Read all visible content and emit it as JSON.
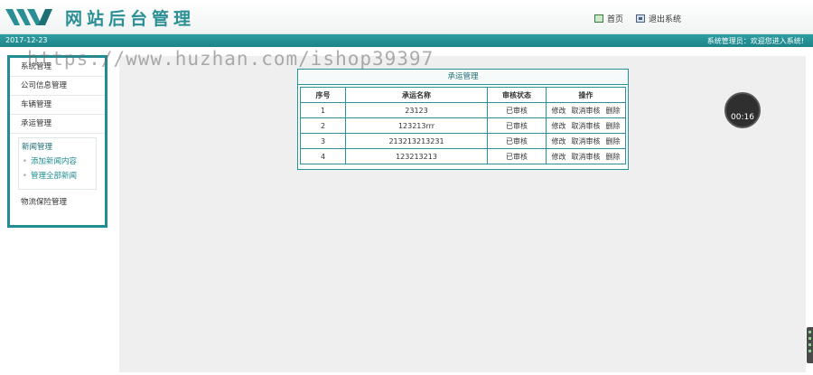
{
  "header": {
    "title": "网站后台管理",
    "home_label": "首页",
    "logout_label": "退出系统"
  },
  "statusbar": {
    "date": "2017-12-23",
    "welcome": "系统管理员：欢迎您进入系统!"
  },
  "sidebar": {
    "items": [
      {
        "label": "系统管理"
      },
      {
        "label": "公司信息管理"
      },
      {
        "label": "车辆管理"
      },
      {
        "label": "承运管理"
      }
    ],
    "group": {
      "title": "新闻管理",
      "subitems": [
        {
          "label": "添加新闻内容"
        },
        {
          "label": "管理全部新闻"
        }
      ]
    },
    "last_item": {
      "label": "物流保险管理"
    }
  },
  "panel": {
    "title": "承运管理",
    "columns": [
      "序号",
      "承运名称",
      "审核状态",
      "操作"
    ],
    "rows": [
      {
        "id": "1",
        "name": "23123",
        "status": "已审核"
      },
      {
        "id": "2",
        "name": "123213rrr",
        "status": "已审核"
      },
      {
        "id": "3",
        "name": "213213213231",
        "status": "已审核"
      },
      {
        "id": "4",
        "name": "123213213",
        "status": "已审核"
      }
    ],
    "ops": {
      "edit": "修改",
      "cancel": "取消审核",
      "delete": "删除"
    }
  },
  "timer": {
    "text": "00:16"
  },
  "watermark": {
    "text": "https://www.huzhan.com/ishop39397"
  },
  "colors": {
    "accent": "#1f8d92",
    "statusbar": "#2a9398"
  }
}
